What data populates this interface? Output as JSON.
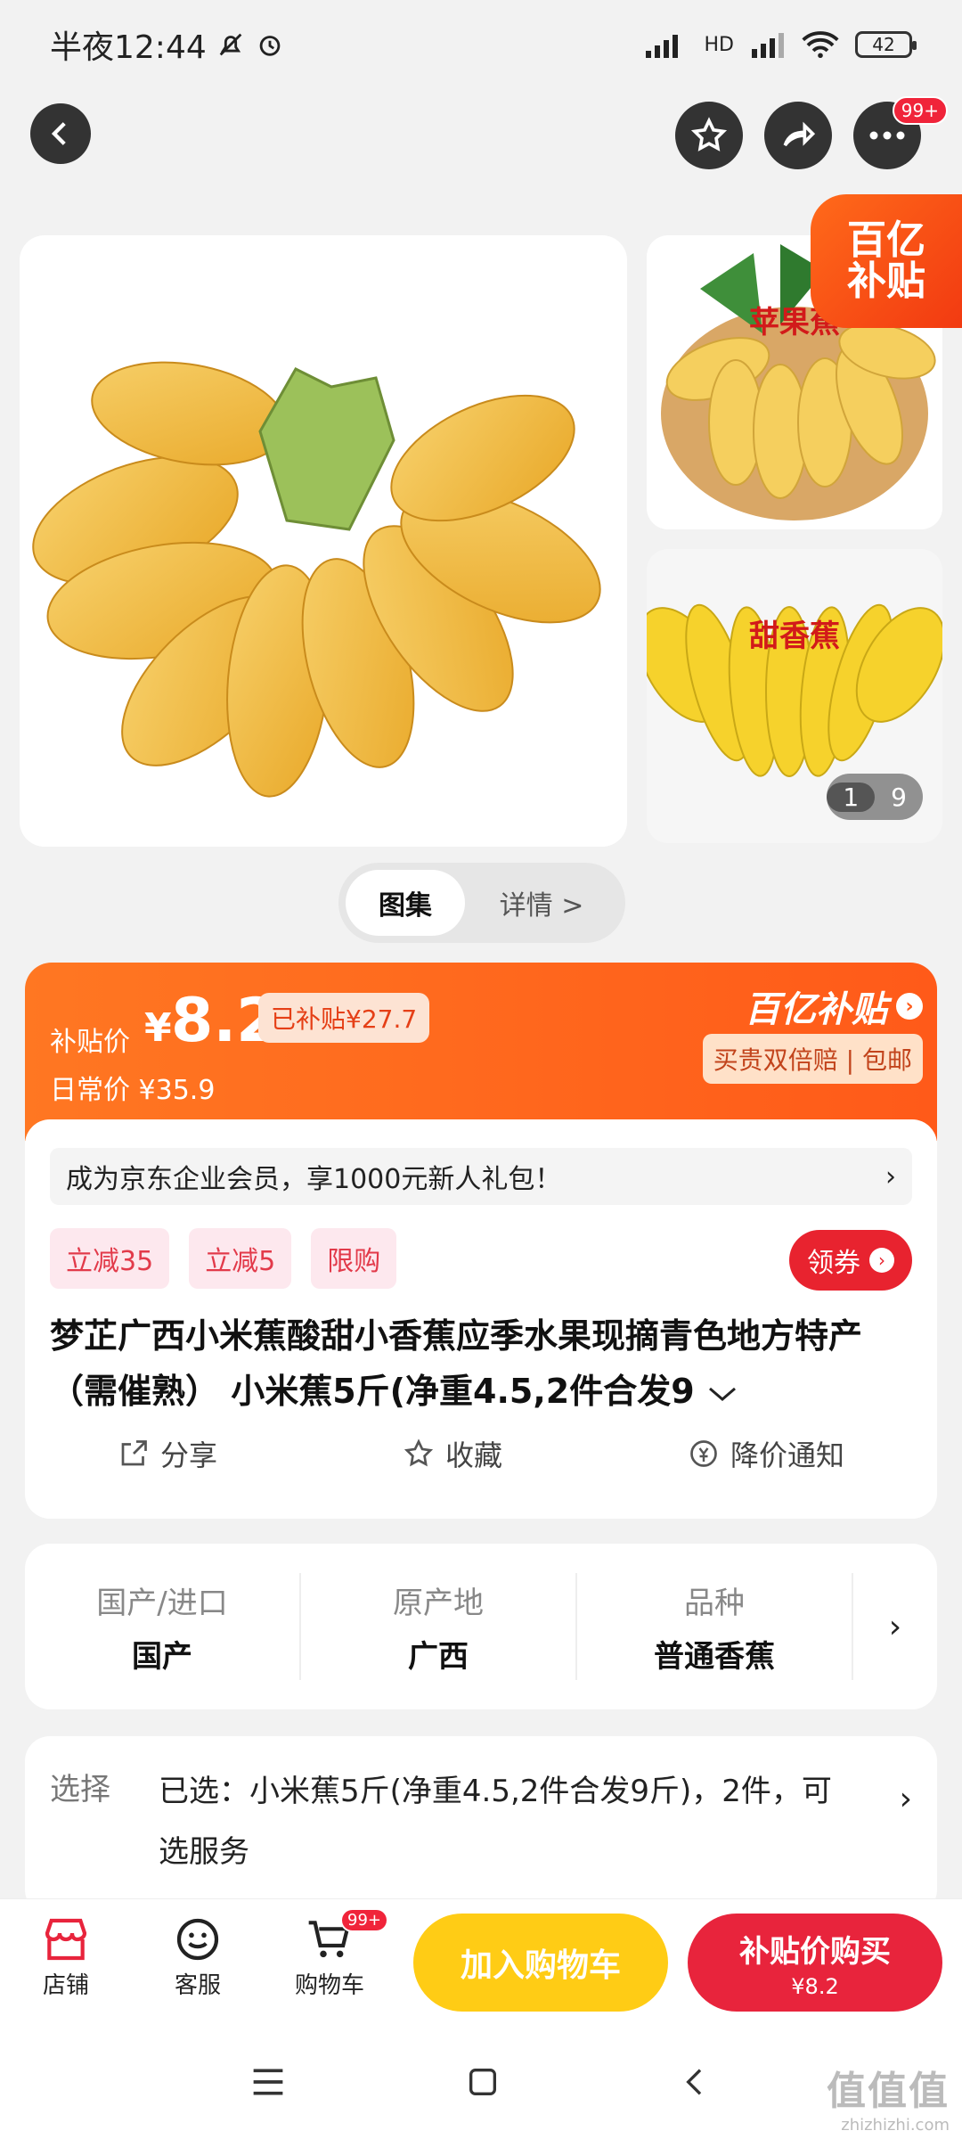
{
  "status": {
    "time": "半夜12:44",
    "battery": "42",
    "network": "HD"
  },
  "header": {
    "more_badge": "99+"
  },
  "gallery": {
    "thumb1_label": "苹果蕉",
    "thumb2_label": "甜香蕉",
    "subsidy_corner_line1": "百亿",
    "subsidy_corner_line2": "补贴",
    "counter_current": "1",
    "counter_total": "9"
  },
  "tabs": {
    "active": "图集",
    "other": "详情 >"
  },
  "price": {
    "label": "补贴价",
    "yen": "¥",
    "value": "8.2",
    "subsidized": "已补贴¥27.7",
    "daily": "日常价 ¥35.9",
    "brand": "百亿补贴",
    "promise": "买贵双倍赔 | 包邮"
  },
  "product": {
    "promo": "成为京东企业会员，享1000元新人礼包！",
    "promo_arrow": "›",
    "chips": [
      "立减35",
      "立减5",
      "限购"
    ],
    "coupon": "领券",
    "title": "梦芷广西小米蕉酸甜小香蕉应季水果现摘青色地方特产（需催熟） 小米蕉5斤(净重4.5,2件合发9",
    "actions": [
      "分享",
      "收藏",
      "降价通知"
    ]
  },
  "specs": [
    {
      "key": "国产/进口",
      "value": "国产"
    },
    {
      "key": "原产地",
      "value": "广西"
    },
    {
      "key": "品种",
      "value": "普通香蕉"
    }
  ],
  "selection": {
    "label": "选择",
    "value": "已选：小米蕉5斤(净重4.5,2件合发9斤)，2件，可选服务"
  },
  "bottom": {
    "shop": "店铺",
    "service": "客服",
    "cart": "购物车",
    "cart_badge": "99+",
    "add_cart": "加入购物车",
    "buy": "补贴价购买",
    "buy_price": "¥8.2"
  },
  "watermark": {
    "big": "值值值",
    "small": "zhizhizhi.com"
  },
  "colors": {
    "accent_orange": "#ff5a19",
    "buy_red": "#e8243c",
    "cart_yellow": "#ffcc15"
  }
}
